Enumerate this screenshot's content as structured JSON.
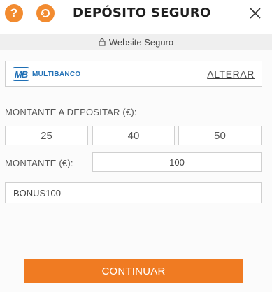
{
  "header": {
    "title": "DEPÓSITO SEGURO",
    "help_icon": "?",
    "close_icon": "close-icon",
    "accent_color": "#f28b30"
  },
  "secure_bar": {
    "text": "Website Seguro",
    "icon": "lock-icon"
  },
  "payment_method": {
    "logo_badge": "MB",
    "logo_text": "MULTIBANCO",
    "change_label": "ALTERAR"
  },
  "deposit": {
    "amount_label": "MONTANTE A DEPOSITAR (€):",
    "quick_amounts": [
      "25",
      "40",
      "50"
    ],
    "input_label": "MONTANTE (€):",
    "input_value": "100"
  },
  "bonus": {
    "value": "BONUS100"
  },
  "continue_button": {
    "label": "CONTINUAR",
    "color": "#f07b22"
  }
}
